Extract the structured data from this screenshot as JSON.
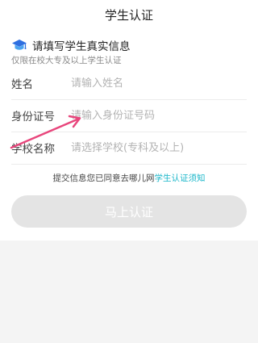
{
  "header": {
    "title": "学生认证"
  },
  "section": {
    "icon": "graduation-cap-icon",
    "title": "请填写学生真实信息",
    "subtitle": "仅限在校大专及以上学生认证"
  },
  "form": {
    "name": {
      "label": "姓名",
      "placeholder": "请输入姓名",
      "value": ""
    },
    "id_number": {
      "label": "身份证号",
      "placeholder": "请输入身份证号码",
      "value": ""
    },
    "school": {
      "label": "学校名称",
      "placeholder": "请选择学校(专科及以上)",
      "value": ""
    }
  },
  "agreement": {
    "text": "提交信息您已同意去哪儿网",
    "link": "学生认证须知"
  },
  "submit": {
    "label": "马上认证"
  },
  "colors": {
    "link": "#19b6c9",
    "arrow": "#e8467c",
    "button_disabled": "#e4e4e4",
    "icon_blue": "#2e6fe0"
  }
}
